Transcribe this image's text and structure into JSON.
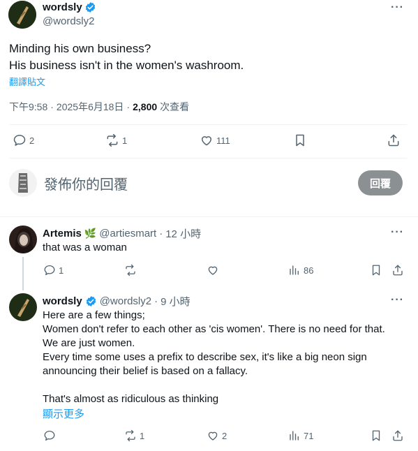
{
  "main_post": {
    "display_name": "wordsly",
    "handle": "@wordsly2",
    "text_line1": "Minding his own business?",
    "text_line2": "His business isn't in the women's washroom.",
    "translate_label": "翻譯貼文",
    "time": "下午9:58",
    "sep1": "·",
    "date": "2025年6月18日",
    "sep2": "·",
    "views_count": "2,800",
    "views_label": "次查看",
    "replies": "2",
    "reposts": "1",
    "likes": "111"
  },
  "compose": {
    "placeholder": "發佈你的回覆",
    "reply_button": "回覆"
  },
  "reply1": {
    "display_name": "Artemis",
    "emoji": "🌿",
    "handle": "@artiesmart",
    "sep": "·",
    "time_ago": "12 小時",
    "text": "that was a woman",
    "replies": "1",
    "views": "86"
  },
  "reply2": {
    "display_name": "wordsly",
    "handle": "@wordsly2",
    "sep": "·",
    "time_ago": "9 小時",
    "lines": [
      "Here are a few things;",
      "Women don't refer to each other as 'cis women'. There is no need for that.",
      "We are just women.",
      "Every time some uses a prefix to describe sex, it's like a big neon sign",
      "announcing their belief is based on a fallacy.",
      "",
      "That's almost as ridiculous as thinking"
    ],
    "show_more": "顯示更多",
    "reposts": "1",
    "likes": "2",
    "views": "71"
  },
  "colors": {
    "accent": "#1d9bf0",
    "text_secondary": "#536471",
    "reply_button_bg": "#8b9093",
    "divider": "#eff3f4"
  },
  "icons": [
    "verified-badge-icon",
    "more-icon",
    "reply-icon",
    "repost-icon",
    "like-icon",
    "bookmark-icon",
    "share-icon",
    "views-icon"
  ]
}
